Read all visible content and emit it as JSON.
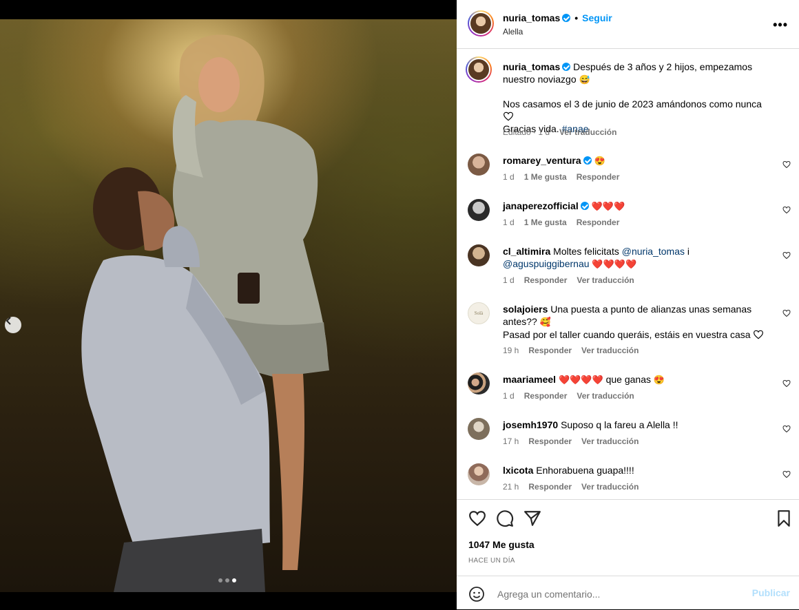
{
  "post": {
    "username": "nuria_tomas",
    "follow_label": "Seguir",
    "location": "Alella",
    "more_label": "•••",
    "carousel_dots": 3,
    "carousel_active": 3
  },
  "caption": {
    "username": "nuria_tomas",
    "line1": "Después de 3 años y 2 hijos, empezamos nuestro noviazgo",
    "line2": "Nos casamos el 3 de junio de 2023 amándonos como nunca",
    "line3": "Gracias vida.",
    "hashtag": "#anae",
    "edited": "Editado · 1 d",
    "translate": "Ver traducción"
  },
  "comments": [
    {
      "user": "romarey_ventura",
      "verified": true,
      "text": "",
      "emoji": "😍",
      "time": "1 d",
      "likes": "1 Me gusta",
      "reply": "Responder",
      "translate": ""
    },
    {
      "user": "janaperezofficial",
      "verified": true,
      "text": "",
      "emoji": "❤️❤️❤️",
      "time": "1 d",
      "likes": "1 Me gusta",
      "reply": "Responder",
      "translate": ""
    },
    {
      "user": "cl_altimira",
      "verified": false,
      "text": "Moltes felicitats",
      "mention1": "@nuria_tomas",
      "mid": "i",
      "mention2": "@aguspuiggibernau",
      "emoji": "❤️❤️❤️❤️",
      "time": "1 d",
      "likes": "",
      "reply": "Responder",
      "translate": "Ver traducción"
    },
    {
      "user": "solajoiers",
      "verified": false,
      "text": "Una puesta a punto de alianzas unas semanas antes??",
      "emoji": "🥰",
      "text2": "Pasad por el taller cuando queráis, estáis en vuestra casa",
      "time": "19 h",
      "likes": "",
      "reply": "Responder",
      "translate": "Ver traducción"
    },
    {
      "user": "maariameel",
      "verified": false,
      "text": "que ganas",
      "emoji": "❤️❤️❤️❤️",
      "emoji2": "😍",
      "time": "1 d",
      "likes": "",
      "reply": "Responder",
      "translate": "Ver traducción"
    },
    {
      "user": "josemh1970",
      "verified": false,
      "text": "Suposo q la fareu a Alella !!",
      "emoji": "",
      "time": "17 h",
      "likes": "",
      "reply": "Responder",
      "translate": "Ver traducción"
    },
    {
      "user": "lxicota",
      "verified": false,
      "text": "Enhorabuena guapa!!!!",
      "emoji": "",
      "time": "21 h",
      "likes": "",
      "reply": "Responder",
      "translate": "Ver traducción"
    }
  ],
  "footer": {
    "likes_count": "1047 Me gusta",
    "posted": "HACE UN DÍA",
    "comment_placeholder": "Agrega un comentario...",
    "publish_label": "Publicar"
  },
  "colors": {
    "accent": "#0095f6",
    "muted": "#737373",
    "mention": "#00376b",
    "heart": "#ed4956"
  }
}
